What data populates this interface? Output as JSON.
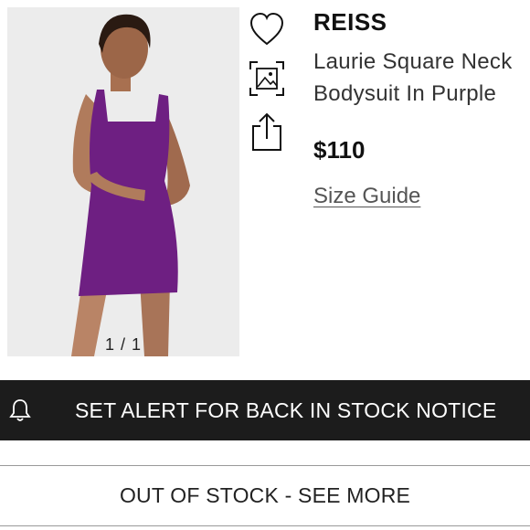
{
  "product": {
    "brand": "REISS",
    "title": "Laurie Square Neck Bodysuit In Purple",
    "price": "$110",
    "size_guide_label": "Size Guide"
  },
  "gallery": {
    "counter": "1 / 1",
    "garment_color": "#6e1f82"
  },
  "icons": {
    "like": "heart-icon",
    "similar": "image-search-icon",
    "share": "share-icon",
    "alert": "bell-icon"
  },
  "actions": {
    "alert_label": "SET ALERT FOR BACK IN STOCK NOTICE",
    "out_of_stock_label": "OUT OF STOCK - SEE MORE"
  },
  "colors": {
    "alert_bar_bg": "#1c1c1c",
    "text_primary": "#111111",
    "link": "#555555"
  }
}
